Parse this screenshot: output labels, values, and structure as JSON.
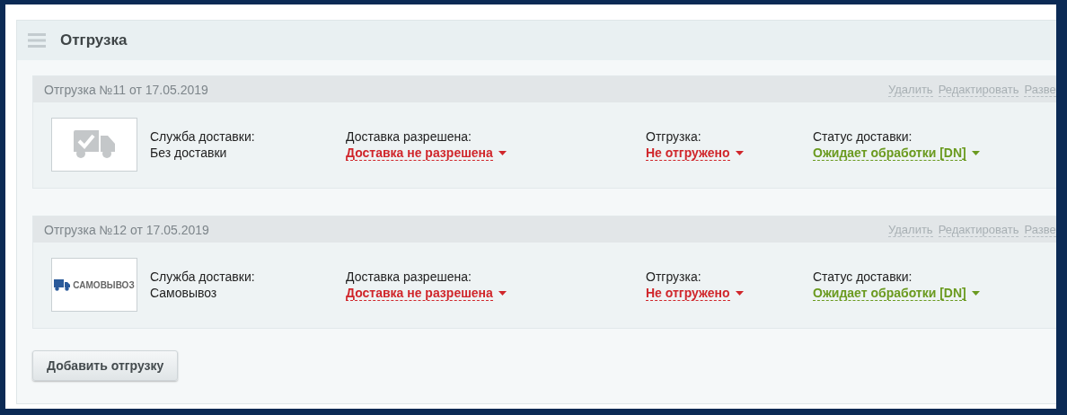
{
  "section": {
    "title": "Отгрузка"
  },
  "shipments": [
    {
      "title": "Отгрузка №11 от 17.05.2019",
      "actions": [
        "Удалить",
        "Редактировать",
        "Разве"
      ],
      "logo": {
        "kind": "truck-check"
      },
      "fields": [
        {
          "label": "Служба доставки:",
          "value": "Без доставки",
          "kind": "text"
        },
        {
          "label": "Доставка разрешена:",
          "value": "Доставка не разрешена",
          "kind": "dropdown",
          "color": "#d0262b"
        },
        {
          "label": "Отгрузка:",
          "value": "Не отгружено",
          "kind": "dropdown",
          "color": "#d0262b"
        },
        {
          "label": "Статус доставки:",
          "value": "Ожидает обработки [DN]",
          "kind": "dropdown",
          "color": "#6a9a1f"
        }
      ]
    },
    {
      "title": "Отгрузка №12 от 17.05.2019",
      "actions": [
        "Удалить",
        "Редактировать",
        "Разве"
      ],
      "logo": {
        "kind": "pickup",
        "text": "САМОВЫВОЗ"
      },
      "fields": [
        {
          "label": "Служба доставки:",
          "value": "Самовывоз",
          "kind": "text"
        },
        {
          "label": "Доставка разрешена:",
          "value": "Доставка не разрешена",
          "kind": "dropdown",
          "color": "#d0262b"
        },
        {
          "label": "Отгрузка:",
          "value": "Не отгружено",
          "kind": "dropdown",
          "color": "#d0262b"
        },
        {
          "label": "Статус доставки:",
          "value": "Ожидает обработки [DN]",
          "kind": "dropdown",
          "color": "#6a9a1f"
        }
      ]
    }
  ],
  "add_button": "Добавить отгрузку"
}
